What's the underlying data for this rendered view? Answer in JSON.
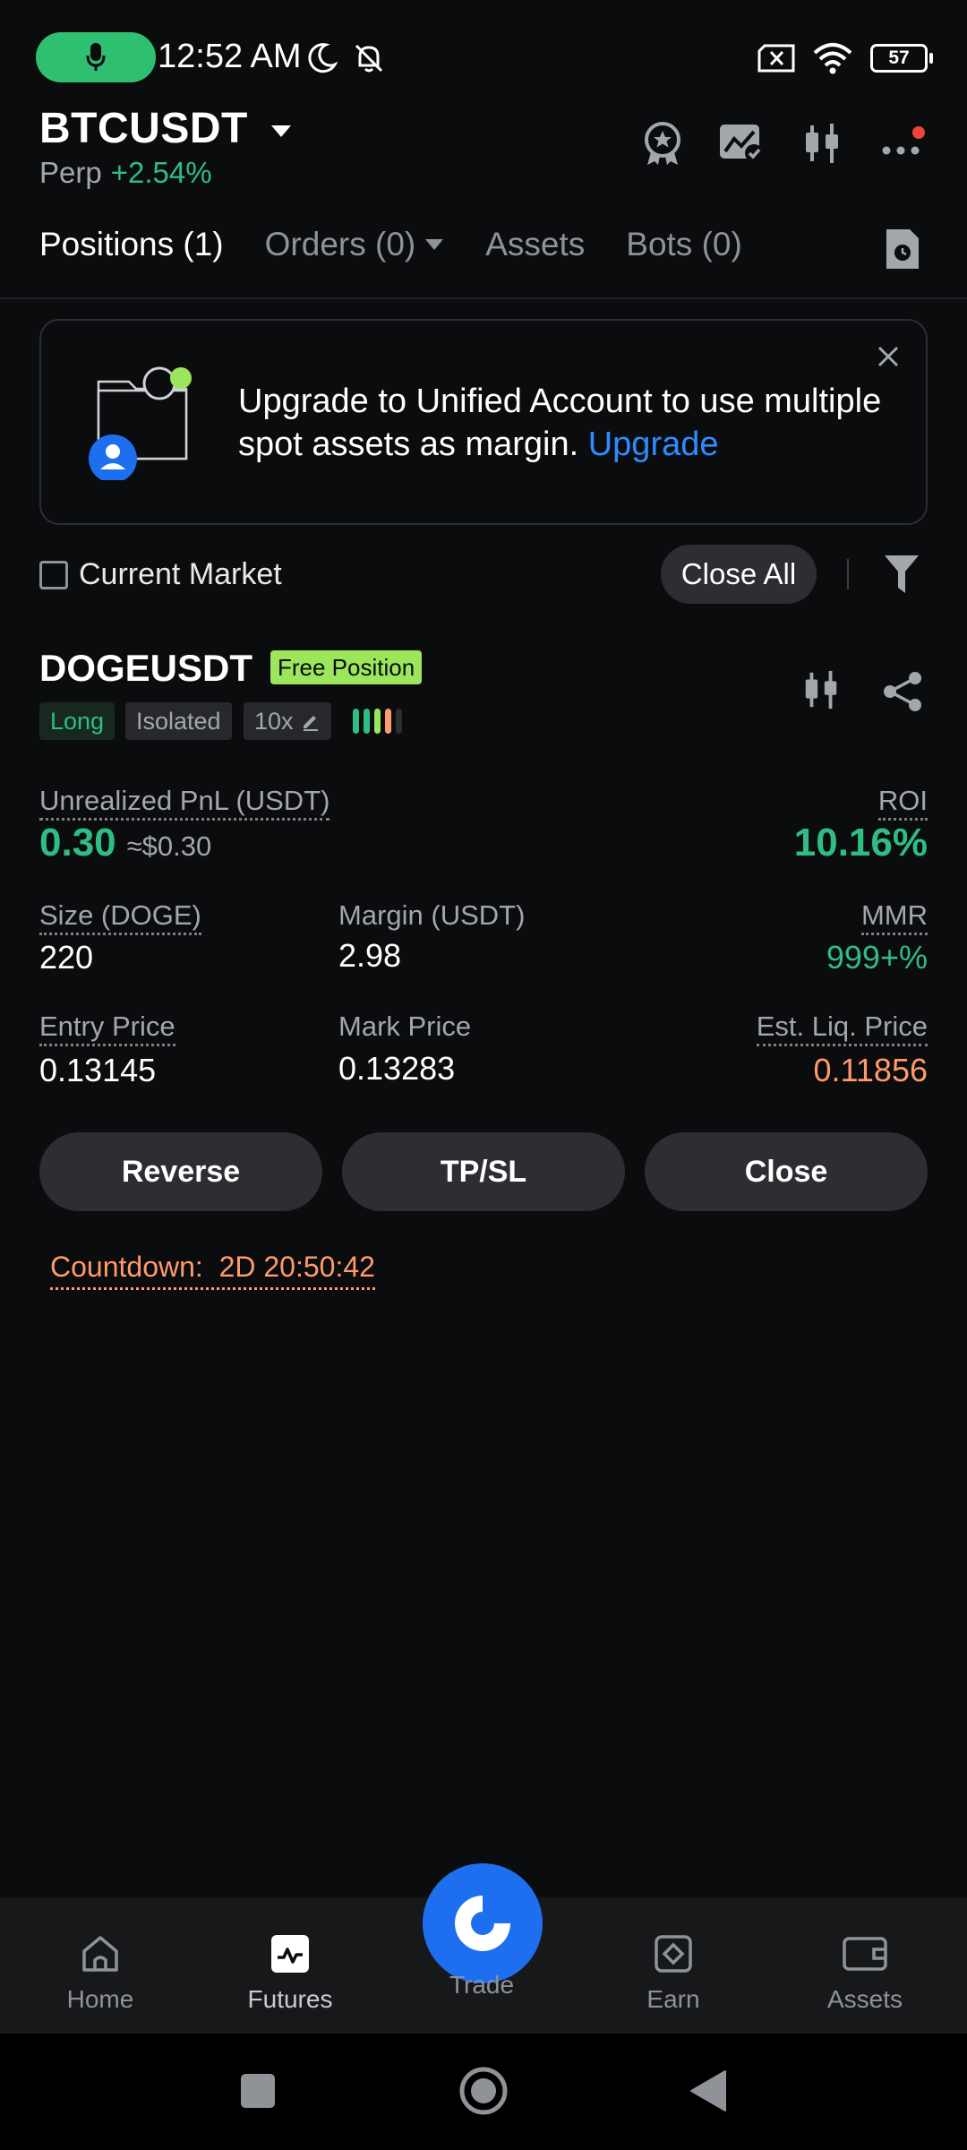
{
  "status_bar": {
    "time": "12:52 AM",
    "battery": "57"
  },
  "header": {
    "symbol": "BTCUSDT",
    "contract": "Perp",
    "change": "+2.54%"
  },
  "tabs": [
    {
      "label": "Positions (1)"
    },
    {
      "label": "Orders (0)"
    },
    {
      "label": "Assets"
    },
    {
      "label": "Bots (0)"
    }
  ],
  "banner": {
    "text": "Upgrade to Unified Account to use multiple spot assets as margin.",
    "link": "Upgrade"
  },
  "filter": {
    "current_market": "Current Market",
    "close_all": "Close All"
  },
  "position": {
    "symbol": "DOGEUSDT",
    "badge": "Free Position",
    "side": "Long",
    "margin_mode": "Isolated",
    "leverage": "10x",
    "unrealized_pnl_label": "Unrealized PnL (USDT)",
    "unrealized_pnl": "0.30",
    "unrealized_pnl_usd": "≈$0.30",
    "roi_label": "ROI",
    "roi": "10.16%",
    "size_label": "Size (DOGE)",
    "size": "220",
    "margin_label": "Margin (USDT)",
    "margin": "2.98",
    "mmr_label": "MMR",
    "mmr": "999+%",
    "entry_price_label": "Entry Price",
    "entry_price": "0.13145",
    "mark_price_label": "Mark Price",
    "mark_price": "0.13283",
    "liq_price_label": "Est. Liq. Price",
    "liq_price": "0.11856"
  },
  "actions": {
    "reverse": "Reverse",
    "tpsl": "TP/SL",
    "close": "Close"
  },
  "countdown": {
    "label": "Countdown:",
    "value": "2D 20:50:42"
  },
  "bottom_nav": [
    {
      "label": "Home"
    },
    {
      "label": "Futures"
    },
    {
      "label": "Trade"
    },
    {
      "label": "Earn"
    },
    {
      "label": "Assets"
    }
  ],
  "colors": {
    "accent_green": "#2ebd85",
    "accent_blue": "#2f8bff",
    "accent_orange": "#ff9a6b",
    "badge_green": "#9be65a"
  }
}
